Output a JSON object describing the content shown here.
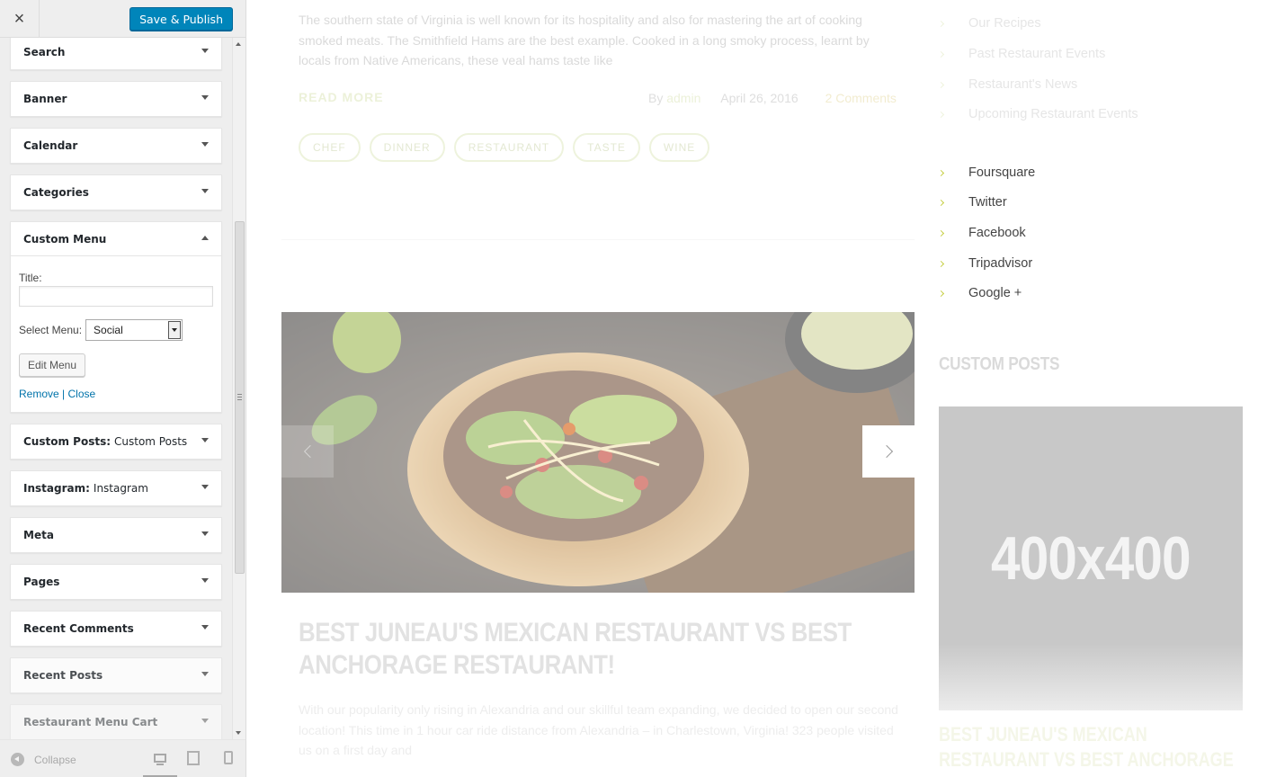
{
  "header": {
    "close_icon": "×",
    "publish_label": "Save & Publish"
  },
  "widgets": [
    {
      "title": "Search",
      "subtitle": ""
    },
    {
      "title": "Banner",
      "subtitle": ""
    },
    {
      "title": "Calendar",
      "subtitle": ""
    },
    {
      "title": "Categories",
      "subtitle": ""
    },
    {
      "title": "Custom Menu",
      "subtitle": "",
      "expanded": true
    },
    {
      "title": "Custom Posts:",
      "subtitle": "Custom Posts"
    },
    {
      "title": "Instagram:",
      "subtitle": "Instagram"
    },
    {
      "title": "Meta",
      "subtitle": ""
    },
    {
      "title": "Pages",
      "subtitle": ""
    },
    {
      "title": "Recent Comments",
      "subtitle": ""
    },
    {
      "title": "Recent Posts",
      "subtitle": ""
    },
    {
      "title": "Restaurant Menu Cart",
      "subtitle": ""
    }
  ],
  "custom_menu": {
    "title_label": "Title:",
    "title_value": "",
    "select_label": "Select Menu:",
    "select_value": "Social",
    "edit_label": "Edit Menu",
    "remove_label": "Remove",
    "separator": "|",
    "close_label": "Close"
  },
  "footer": {
    "collapse_label": "Collapse",
    "devices": [
      "desktop",
      "tablet",
      "mobile"
    ],
    "selected_device": "desktop"
  },
  "preview": {
    "excerpt1": "The southern state of Virginia is well known for its hospitality and also for mastering the art of cooking smoked meats. The Smithfield Hams are the best example. Cooked in a long smoky process, learnt by locals from Native Americans, these veal hams taste like",
    "read_more": "READ MORE",
    "meta": {
      "by": "By",
      "author": "admin",
      "date": "April 26, 2016",
      "comments": "2 Comments"
    },
    "tags": [
      "CHEF",
      "DINNER",
      "RESTAURANT",
      "TASTE",
      "WINE"
    ],
    "post_title": "BEST JUNEAU'S MEXICAN RESTAURANT VS BEST ANCHORAGE RESTAURANT!",
    "excerpt2": "With our popularity only rising in Alexandria and our skillful team expanding, we decided to open our second location! This time in 1 hour car ride distance from Alexandria – in Charlestown, Virginia! 323 people visited us on a first day and"
  },
  "sidebar_right": {
    "categories": [
      "Our Recipes",
      "Past Restaurant Events",
      "Restaurant's News",
      "Upcoming Restaurant Events"
    ],
    "social_menu": [
      "Foursquare",
      "Twitter",
      "Facebook",
      "Tripadvisor",
      "Google +"
    ],
    "custom_posts_heading": "CUSTOM POSTS",
    "thumb_text": "400x400",
    "custom_post_title": "BEST JUNEAU'S MEXICAN RESTAURANT VS BEST ANCHORAGE RESTAURANT!"
  },
  "colors": {
    "accent": "#c7cf46",
    "publish": "#0085ba",
    "link": "#0073aa"
  }
}
